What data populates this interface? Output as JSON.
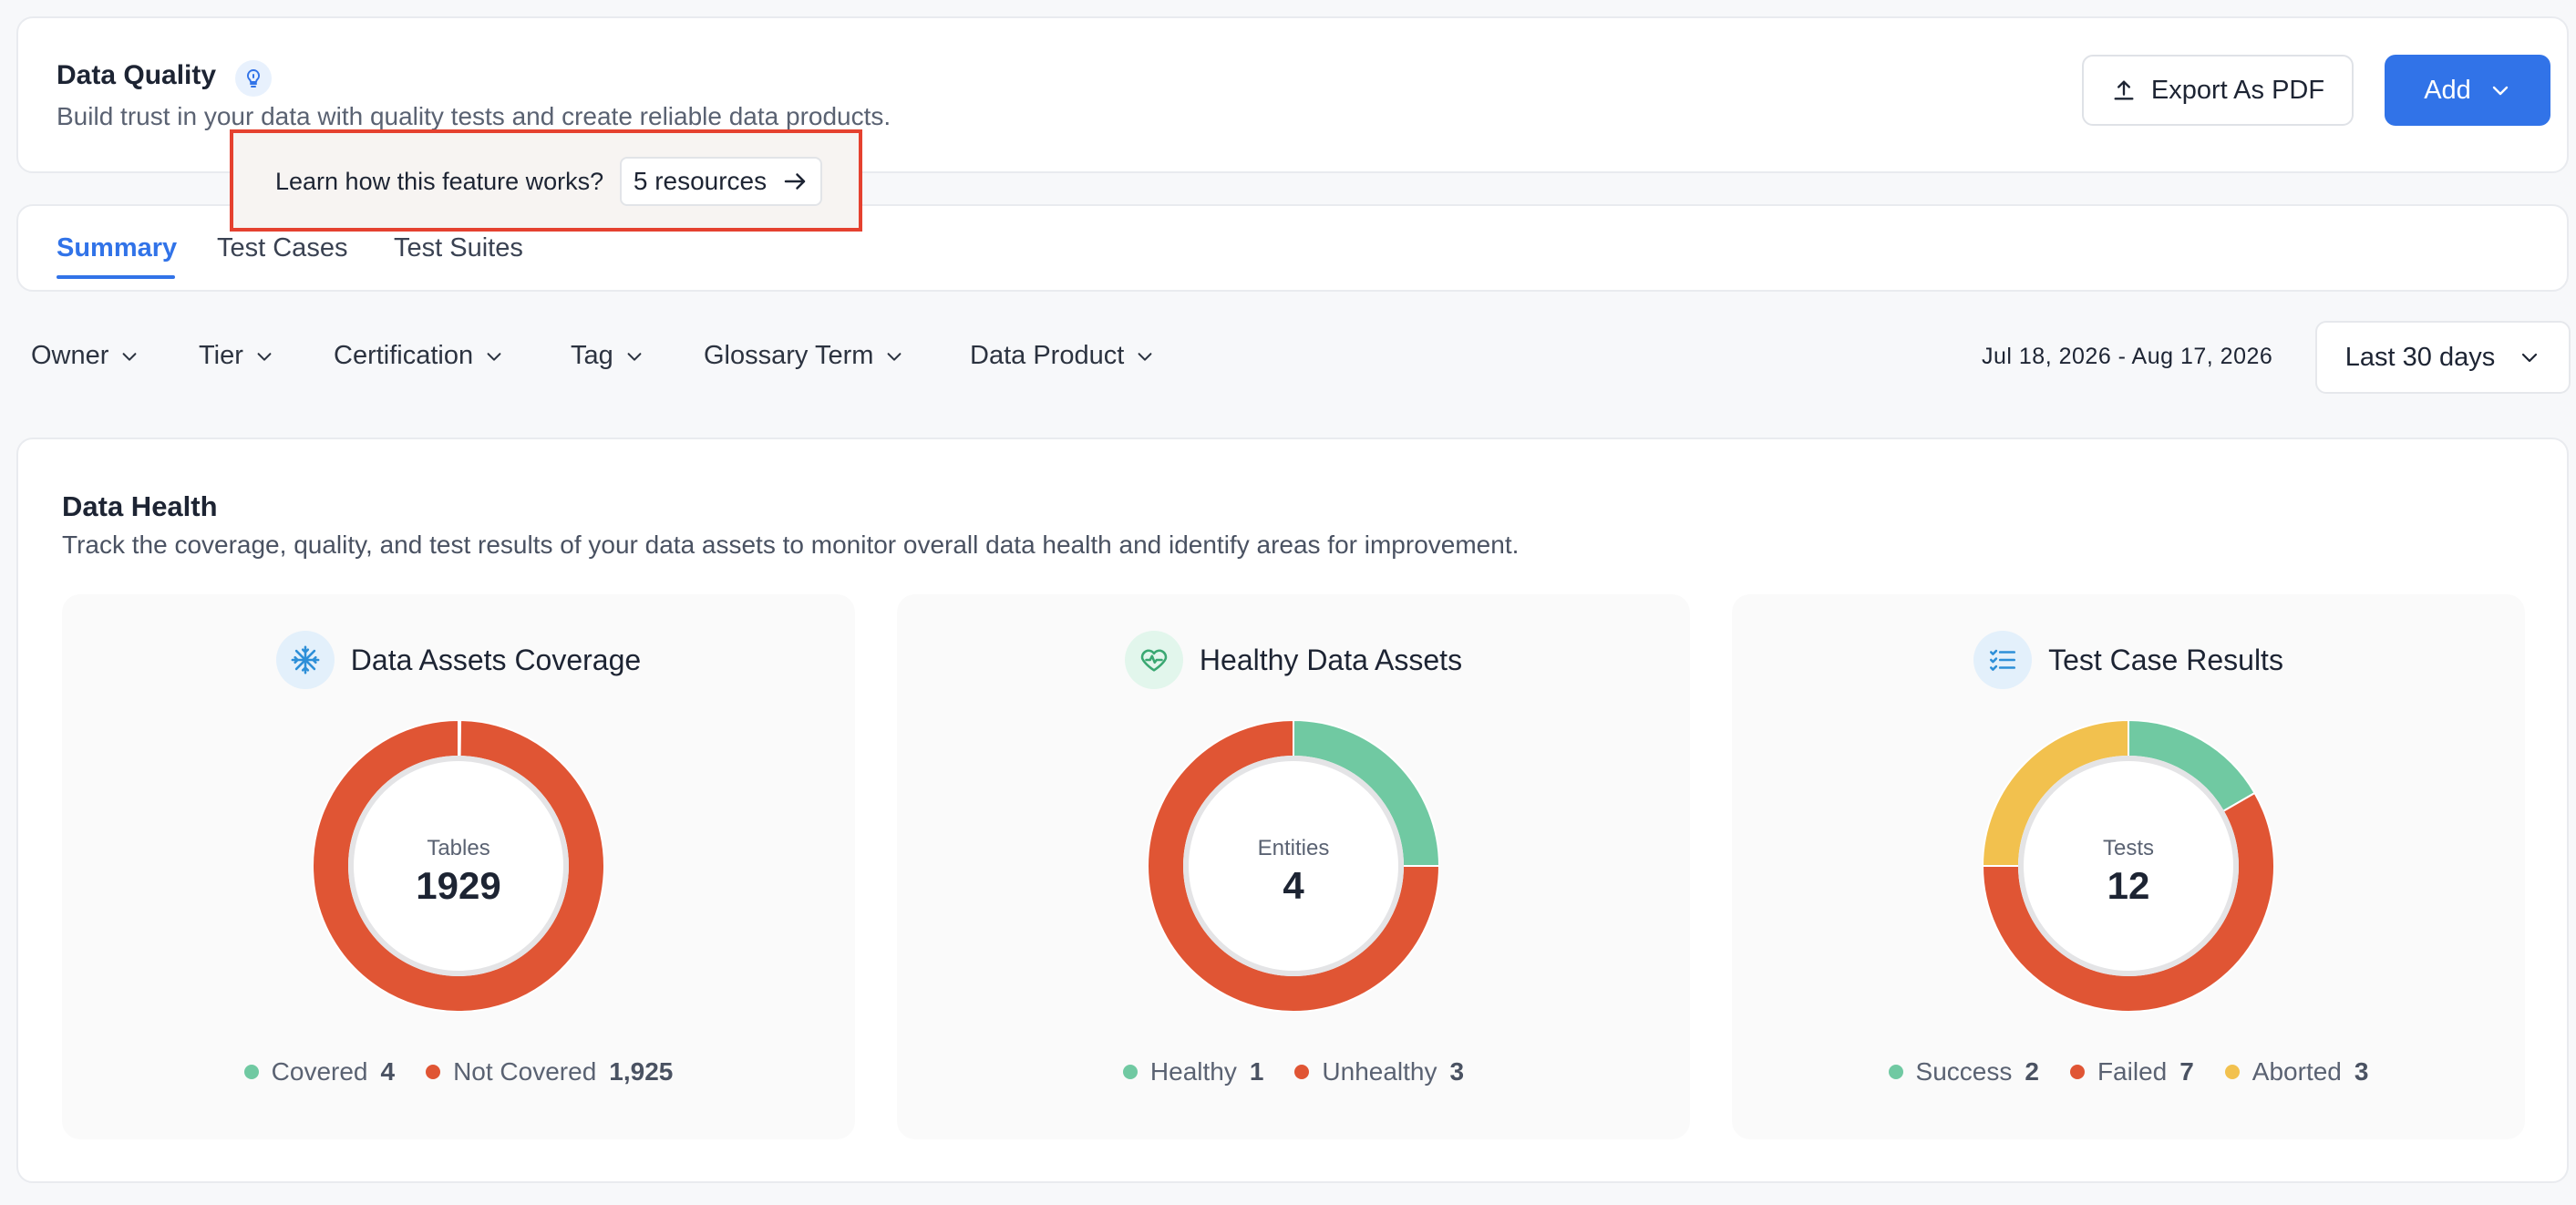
{
  "header": {
    "title": "Data Quality",
    "subtitle": "Build trust in your data with quality tests and create reliable data products.",
    "export_label": "Export As PDF",
    "add_label": "Add"
  },
  "learn": {
    "text": "Learn how this feature works?",
    "resources_label": "5 resources"
  },
  "tabs": [
    {
      "label": "Summary",
      "active": true
    },
    {
      "label": "Test Cases",
      "active": false
    },
    {
      "label": "Test Suites",
      "active": false
    }
  ],
  "filters": [
    "Owner",
    "Tier",
    "Certification",
    "Tag",
    "Glossary Term",
    "Data Product"
  ],
  "date_range": "Jul 18, 2026 - Aug 17, 2026",
  "period": "Last 30 days",
  "health": {
    "title": "Data Health",
    "description": "Track the coverage, quality, and test results of your data assets to monitor overall data health and identify areas for improvement."
  },
  "colors": {
    "green": "#70c9a2",
    "red": "#e05534",
    "yellow": "#f2c14e",
    "blue": "#3173e8"
  },
  "panels": [
    {
      "title": "Data Assets Coverage",
      "icon": "snowflake-icon",
      "center_label": "Tables",
      "center_value": "1929",
      "legend": [
        {
          "label": "Covered",
          "value": "4",
          "count": 4,
          "color": "#70c9a2"
        },
        {
          "label": "Not Covered",
          "value": "1,925",
          "count": 1925,
          "color": "#e05534"
        }
      ]
    },
    {
      "title": "Healthy Data Assets",
      "icon": "heart-pulse-icon",
      "center_label": "Entities",
      "center_value": "4",
      "legend": [
        {
          "label": "Healthy",
          "value": "1",
          "count": 1,
          "color": "#70c9a2"
        },
        {
          "label": "Unhealthy",
          "value": "3",
          "count": 3,
          "color": "#e05534"
        }
      ]
    },
    {
      "title": "Test Case Results",
      "icon": "checklist-icon",
      "center_label": "Tests",
      "center_value": "12",
      "legend": [
        {
          "label": "Success",
          "value": "2",
          "count": 2,
          "color": "#70c9a2"
        },
        {
          "label": "Failed",
          "value": "7",
          "count": 7,
          "color": "#e05534"
        },
        {
          "label": "Aborted",
          "value": "3",
          "count": 3,
          "color": "#f2c14e"
        }
      ]
    }
  ]
}
